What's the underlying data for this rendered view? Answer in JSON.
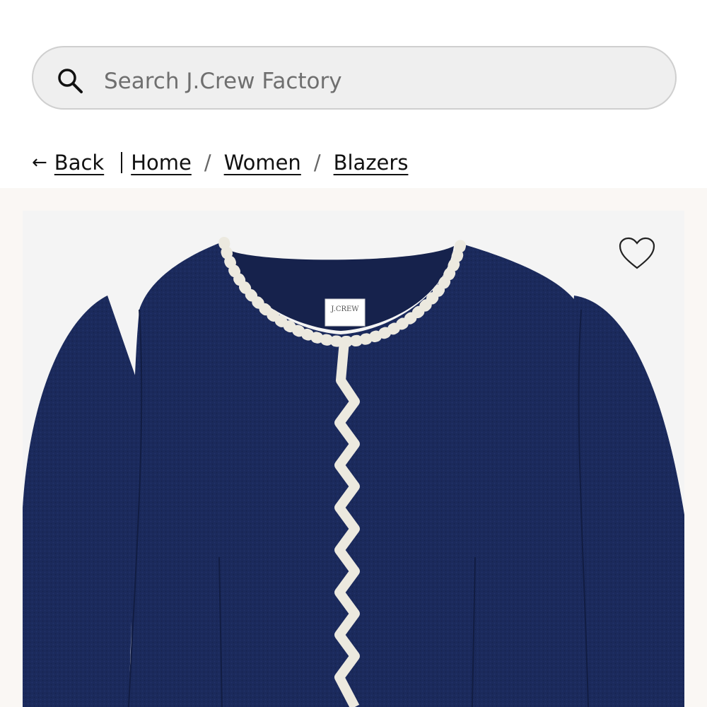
{
  "search": {
    "placeholder": "Search J.Crew Factory",
    "icon": "search-icon"
  },
  "breadcrumb": {
    "back_arrow": "←",
    "back_label": "Back",
    "items": [
      "Home",
      "Women",
      "Blazers"
    ],
    "separator": "/"
  },
  "product": {
    "label_text": "J.CREW",
    "colors": {
      "jacket": "#1b2a5c",
      "trim": "#ece9df",
      "background": "#f4f4f4",
      "gallery_background": "#faf7f4"
    },
    "favorite_icon": "heart-icon"
  }
}
